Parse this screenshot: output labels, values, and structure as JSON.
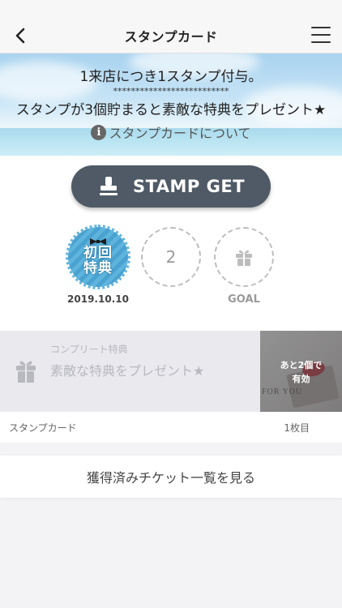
{
  "nav": {
    "title": "スタンプカード"
  },
  "banner": {
    "line1": "1来店につき1スタンプ付与。",
    "stars": "**************************",
    "line2": "スタンプが3個貯まると素敵な特典をプレゼント★",
    "info_link": "スタンプカードについて",
    "info_icon": "i"
  },
  "stamp_button": {
    "label": "STAMP GET",
    "icon": "stamp-icon"
  },
  "slots": [
    {
      "type": "stamped",
      "badge_text": "初回\n特典",
      "date": "2019.10.10"
    },
    {
      "type": "empty",
      "number": "2"
    },
    {
      "type": "goal",
      "label": "GOAL",
      "icon": "gift-icon"
    }
  ],
  "reward": {
    "subtitle": "コンプリート特典",
    "title": "素敵な特典をプレゼント★",
    "remaining": "あと2個で",
    "remaining_line2": "有効",
    "photo_text": "FOR YOU"
  },
  "card_footer": {
    "left": "スタンプカード",
    "right": "1枚目"
  },
  "tickets_link": "獲得済みチケット一覧を見る",
  "colors": {
    "button_bg": "#4f5a66",
    "badge_blue": "#5fb4de",
    "background": "#f3f3f5"
  }
}
